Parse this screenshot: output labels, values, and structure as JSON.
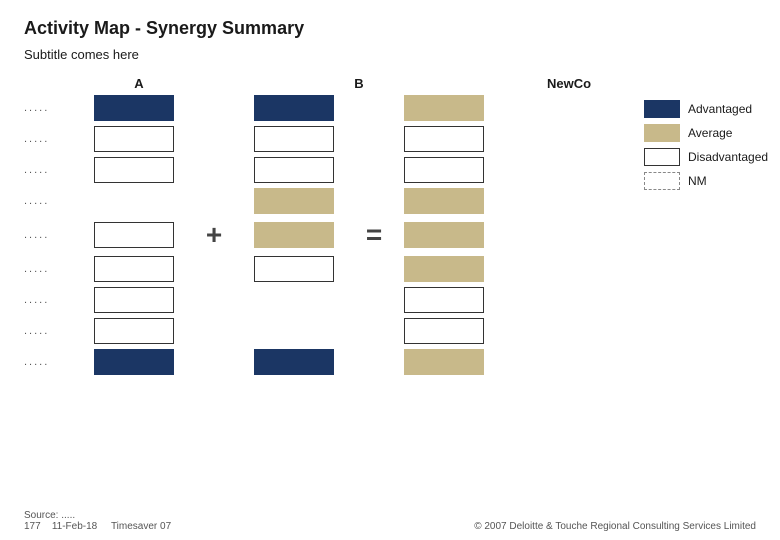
{
  "title": "Activity Map - Synergy Summary",
  "subtitle": "Subtitle comes here",
  "columns": {
    "a": "A",
    "b": "B",
    "newco": "NewCo"
  },
  "rows": [
    {
      "label": ".....",
      "a": "navy",
      "b": "navy",
      "newco": "tan"
    },
    {
      "label": ".....",
      "a": "empty",
      "b": "empty",
      "newco": "empty"
    },
    {
      "label": ".....",
      "a": "empty",
      "b": "empty",
      "newco": "empty"
    },
    {
      "label": ".....",
      "a": "none",
      "b": "tan",
      "newco": "tan"
    },
    {
      "label": ".....",
      "a": "empty",
      "b": "tan",
      "newco": "tan"
    },
    {
      "label": ".....",
      "a": "empty",
      "b": "empty",
      "newco": "tan"
    },
    {
      "label": ".....",
      "a": "empty",
      "b": "none",
      "newco": "empty"
    },
    {
      "label": ".....",
      "a": "empty",
      "b": "none",
      "newco": "empty"
    },
    {
      "label": ".....",
      "a": "navy",
      "b": "navy",
      "newco": "tan"
    }
  ],
  "legend": [
    {
      "type": "navy",
      "label": "Advantaged"
    },
    {
      "type": "tan",
      "label": "Average"
    },
    {
      "type": "empty",
      "label": "Disadvantaged"
    },
    {
      "type": "nm",
      "label": "NM"
    }
  ],
  "footer": {
    "source_label": "Source:",
    "source_value": ".....",
    "page": "177",
    "date": "11-Feb-18",
    "tool": "Timesaver 07",
    "copyright": "© 2007 Deloitte & Touche Regional Consulting Services Limited"
  },
  "operators": {
    "plus": "+",
    "equals": "="
  }
}
